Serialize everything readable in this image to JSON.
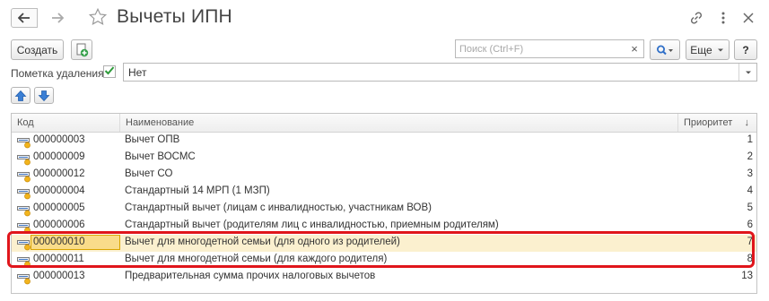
{
  "window": {
    "title": "Вычеты ИПН"
  },
  "toolbar": {
    "create_label": "Создать",
    "search_placeholder": "Поиск (Ctrl+F)",
    "search_value": "",
    "search_clear": "×",
    "more_label": "Еще",
    "help_label": "?"
  },
  "filter": {
    "label": "Пометка удаления:",
    "checked": true,
    "value": "Нет"
  },
  "table": {
    "columns": {
      "code": "Код",
      "name": "Наименование",
      "priority": "Приоритет",
      "sort_indicator": "↓"
    },
    "rows": [
      {
        "code": "000000003",
        "name": "Вычет ОПВ",
        "priority": "1"
      },
      {
        "code": "000000009",
        "name": "Вычет ВОСМС",
        "priority": "2"
      },
      {
        "code": "000000012",
        "name": "Вычет СО",
        "priority": "3"
      },
      {
        "code": "000000004",
        "name": "Стандартный 14 МРП (1 МЗП)",
        "priority": "4"
      },
      {
        "code": "000000005",
        "name": "Стандартный вычет (лицам с инвалидностью, участникам ВОВ)",
        "priority": "5"
      },
      {
        "code": "000000006",
        "name": "Стандартный вычет (родителям лиц с инвалидностью, приемным родителям)",
        "priority": "6"
      },
      {
        "code": "000000010",
        "name": "Вычет для многодетной семьи (для одного из родителей)",
        "priority": "7"
      },
      {
        "code": "000000011",
        "name": "Вычет для многодетной семьи (для каждого родителя)",
        "priority": "8"
      },
      {
        "code": "000000013",
        "name": "Предварительная сумма прочих налоговых вычетов",
        "priority": "13"
      }
    ],
    "selected_row": 6
  },
  "colors": {
    "selection": "#fbf0cf",
    "selected_cell": "#f9dc8a",
    "highlight_frame": "#e0151b",
    "accent_blue": "#3a7fd5",
    "check_green": "#2e9b3a"
  },
  "icons": {
    "back": "arrow-left-icon",
    "forward": "arrow-right-icon",
    "favorite": "star-icon",
    "link": "link-icon",
    "menu": "more-vertical-icon",
    "close": "close-icon",
    "add_copy": "add-copy-icon",
    "search": "magnifier-icon",
    "move_up": "arrow-up-icon",
    "move_down": "arrow-down-icon",
    "row": "catalog-item-icon"
  }
}
